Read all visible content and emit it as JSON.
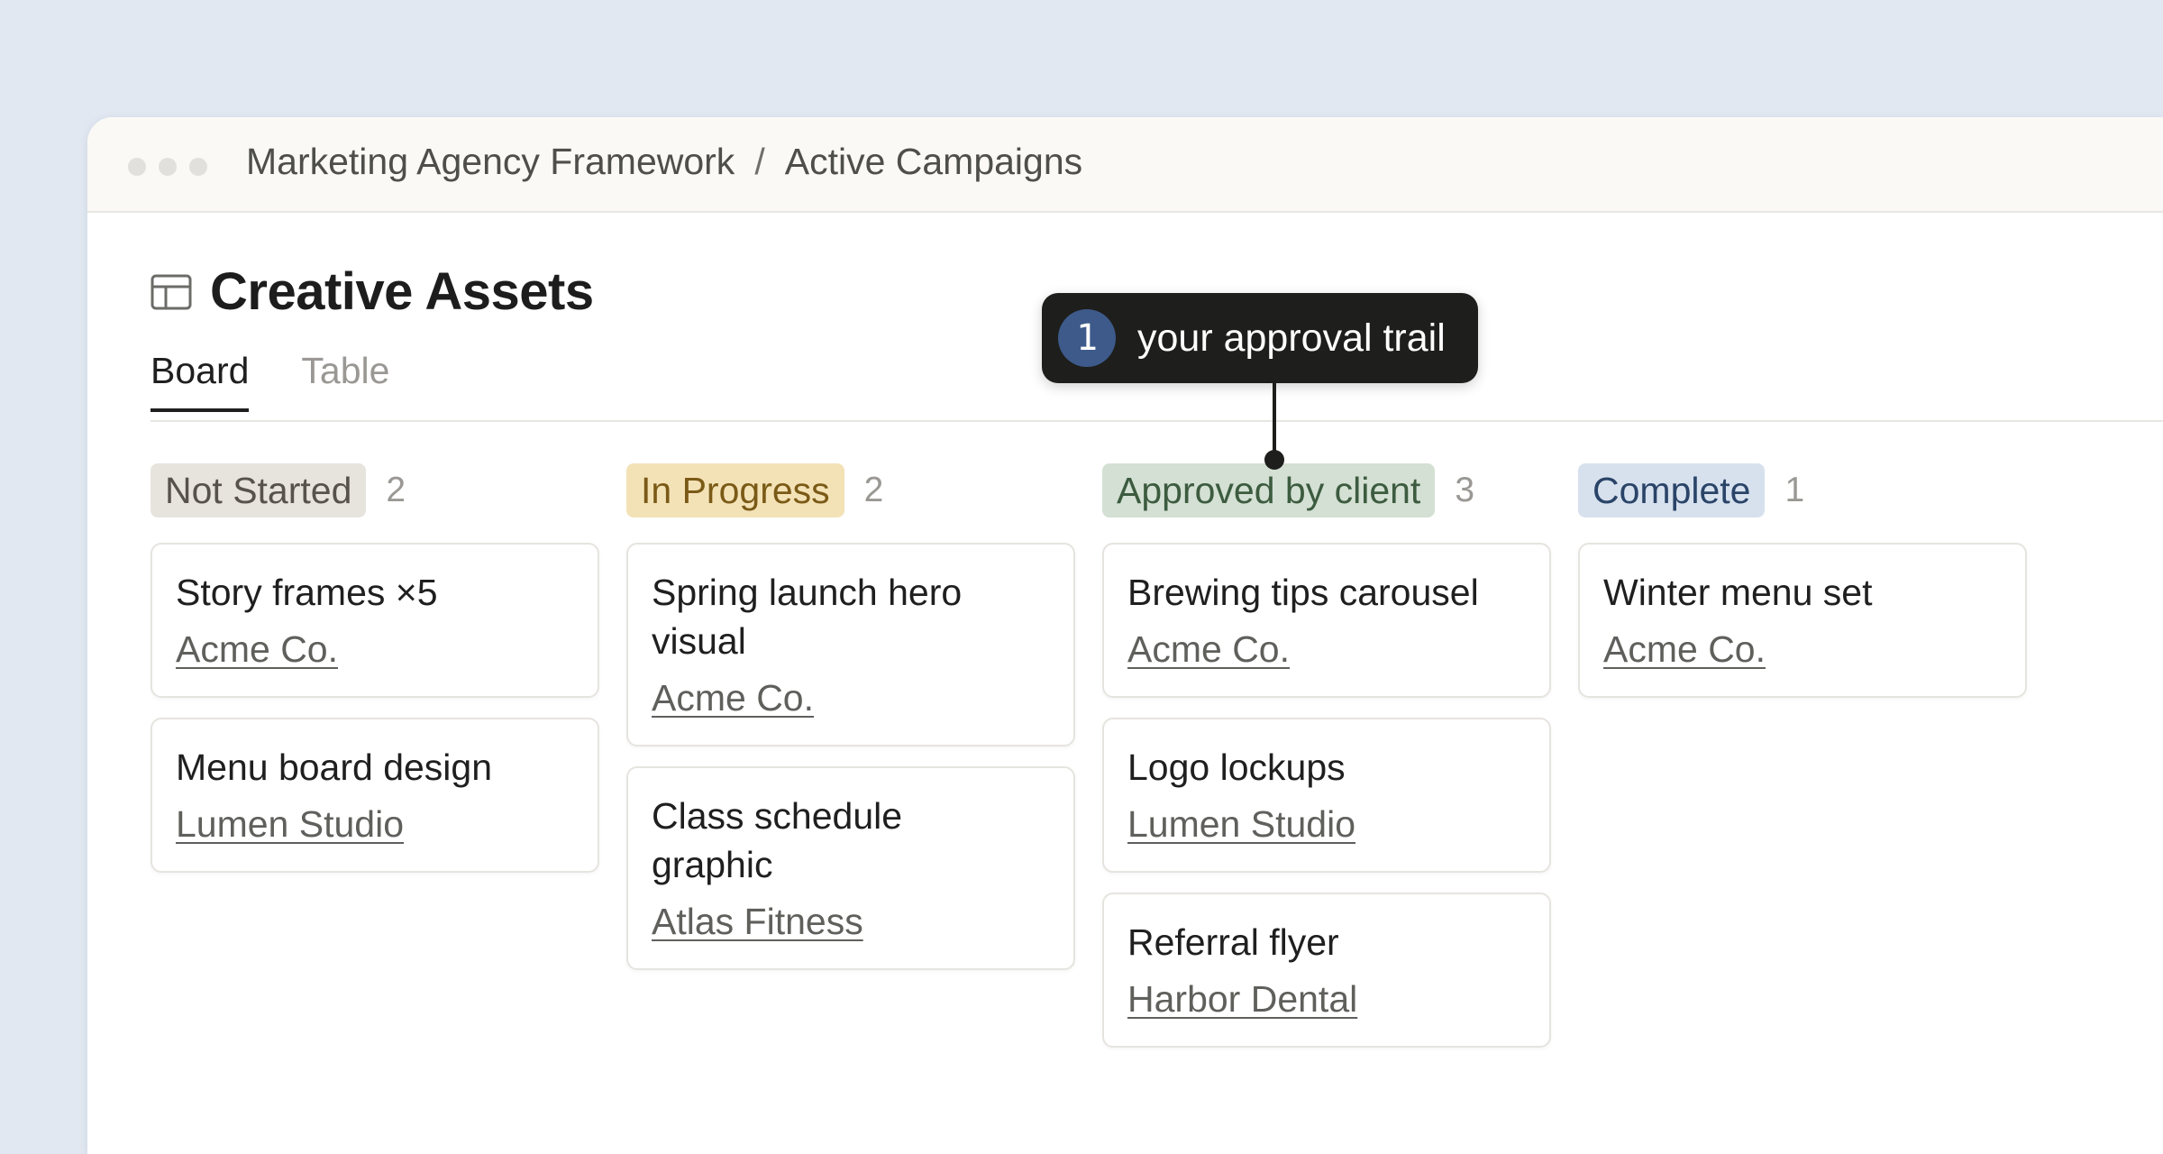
{
  "breadcrumb": {
    "workspace": "Marketing Agency Framework",
    "separator": "/",
    "page": "Active Campaigns"
  },
  "page": {
    "icon": "table-icon",
    "title": "Creative Assets"
  },
  "tabs": [
    {
      "label": "Board",
      "active": true
    },
    {
      "label": "Table",
      "active": false
    }
  ],
  "callout": {
    "number": "1",
    "text": "your approval trail"
  },
  "columns": [
    {
      "label": "Not Started",
      "count": "2",
      "pill_bg": "#e7e4de",
      "pill_fg": "#57534c",
      "cards": [
        {
          "title": "Story frames ×5",
          "client": "Acme Co."
        },
        {
          "title": "Menu board design",
          "client": "Lumen Studio"
        }
      ]
    },
    {
      "label": "In Progress",
      "count": "2",
      "pill_bg": "#f4e2b7",
      "pill_fg": "#7a5a16",
      "cards": [
        {
          "title": "Spring launch hero visual",
          "client": "Acme Co."
        },
        {
          "title": "Class schedule graphic",
          "client": "Atlas Fitness"
        }
      ]
    },
    {
      "label": "Approved by client",
      "count": "3",
      "pill_bg": "#d3e0d3",
      "pill_fg": "#3c5b3f",
      "cards": [
        {
          "title": "Brewing tips carousel",
          "client": "Acme Co."
        },
        {
          "title": "Logo lockups",
          "client": "Lumen Studio"
        },
        {
          "title": "Referral flyer",
          "client": "Harbor Dental"
        }
      ]
    },
    {
      "label": "Complete",
      "count": "1",
      "pill_bg": "#d7e1ee",
      "pill_fg": "#2a4468",
      "cards": [
        {
          "title": "Winter menu set",
          "client": "Acme Co."
        }
      ]
    }
  ]
}
